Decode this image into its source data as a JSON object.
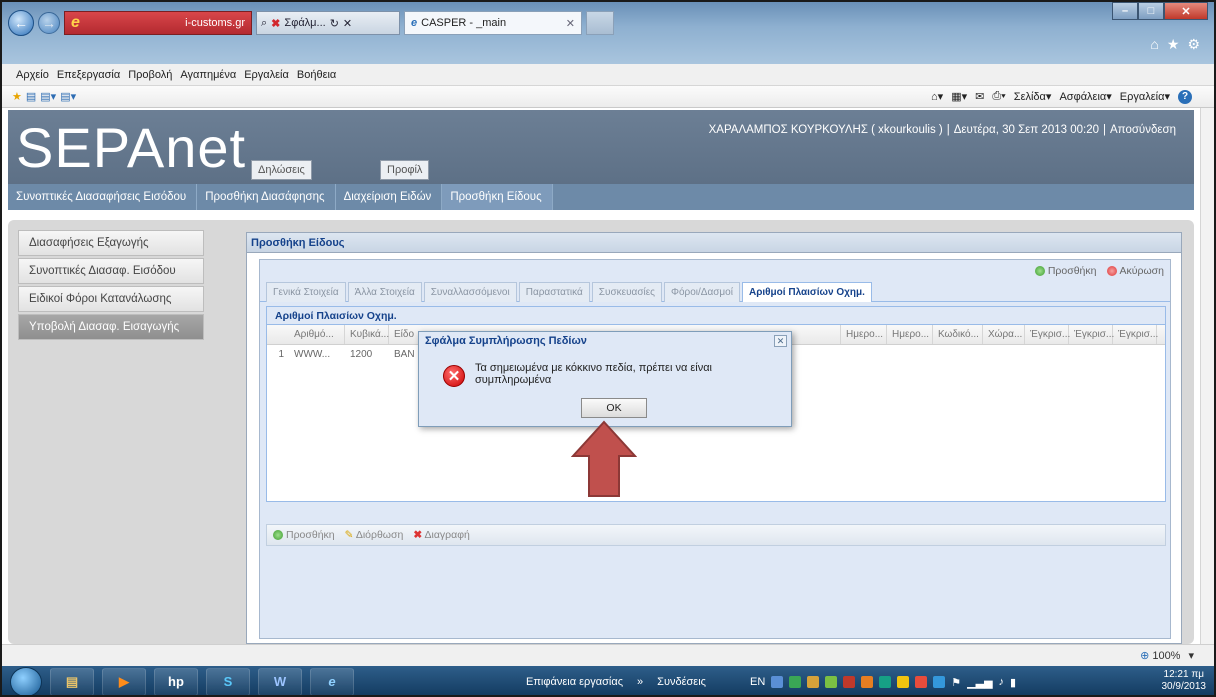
{
  "browser": {
    "address": "i-customs.gr",
    "search_tab_title": "Σφάλμ...",
    "tab_title": "CASPER - _main"
  },
  "menu": [
    "Αρχείο",
    "Επεξεργασία",
    "Προβολή",
    "Αγαπημένα",
    "Εργαλεία",
    "Βοήθεια"
  ],
  "commandbar": {
    "items": [
      "Σελίδα",
      "Ασφάλεια",
      "Εργαλεία"
    ]
  },
  "header": {
    "logo": "SEPAnet",
    "buttons": [
      "Δηλώσεις",
      "Προφίλ"
    ],
    "user": "ΧΑΡΑΛΑΜΠΟΣ ΚΟΥΡΚΟΥΛΗΣ ( xkourkoulis )",
    "date": "Δευτέρα, 30 Σεπ 2013 00:20",
    "logout": "Αποσύνδεση"
  },
  "breadcrumbs": [
    "Συνοπτικές Διασαφήσεις Εισόδου",
    "Προσθήκη Διασάφησης",
    "Διαχείριση Ειδών",
    "Προσθήκη Είδους"
  ],
  "sidebar": [
    "Διασαφήσεις Εξαγωγής",
    "Συνοπτικές Διασαφ. Εισόδου",
    "Ειδικοί Φόροι Κατανάλωσης",
    "Υποβολή Διασαφ. Εισαγωγής"
  ],
  "panel": {
    "title": "Προσθήκη Είδους",
    "add": "Προσθήκη",
    "cancel": "Ακύρωση",
    "tabs": [
      "Γενικά Στοιχεία",
      "Άλλα Στοιχεία",
      "Συναλλασσόμενοι",
      "Παραστατικά",
      "Συσκευασίες",
      "Φόροι/Δασμοί",
      "Αριθμοί Πλαισίων Οχημ."
    ],
    "inner_title": "Αριθμοί Πλαισίων Οχημ.",
    "columns": [
      "Αριθμό...",
      "Κυβικά...",
      "Είδο",
      "Ημερο...",
      "Ημερο...",
      "Κωδικό...",
      "Χώρα...",
      "Έγκρισ...",
      "Έγκρισ...",
      "Έγκρισ..."
    ],
    "row": {
      "num": "1",
      "c1": "WWW...",
      "c2": "1200",
      "c3": "BAN"
    },
    "bottom_add": "Προσθήκη",
    "bottom_edit": "Διόρθωση",
    "bottom_delete": "Διαγραφή"
  },
  "dialog": {
    "title": "Σφάλμα Συμπλήρωσης Πεδίων",
    "message": "Τα σημειωμένα με κόκκινο πεδία, πρέπει να είναι συμπληρωμένα",
    "ok": "OK"
  },
  "statusbar": {
    "zoom": "100%"
  },
  "taskbar": {
    "desktop": "Επιφάνεια εργασίας",
    "links": "Συνδέσεις",
    "lang": "EN",
    "time": "12:21 πμ",
    "date": "30/9/2013"
  },
  "colors": {
    "accent": "#15428b",
    "header": "#667a90",
    "arrow": "#c0504d"
  }
}
